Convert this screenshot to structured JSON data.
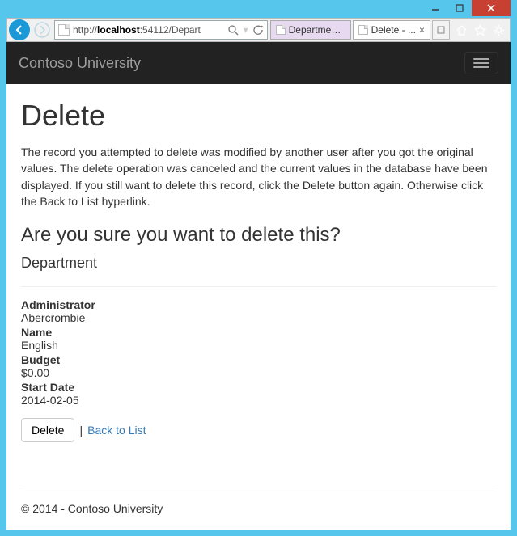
{
  "window": {
    "url_pre": "http://",
    "url_host": "localhost",
    "url_post": ":54112/Depart",
    "tab1": "Department...",
    "tab2": "Delete - ..."
  },
  "navbar": {
    "brand": "Contoso University"
  },
  "page": {
    "title": "Delete",
    "message": "The record you attempted to delete was modified by another user after you got the original values. The delete operation was canceled and the current values in the database have been displayed. If you still want to delete this record, click the Delete button again. Otherwise click the Back to List hyperlink.",
    "confirm": "Are you sure you want to delete this?",
    "entity": "Department"
  },
  "fields": {
    "admin_label": "Administrator",
    "admin_value": "Abercrombie",
    "name_label": "Name",
    "name_value": "English",
    "budget_label": "Budget",
    "budget_value": "$0.00",
    "start_label": "Start Date",
    "start_value": "2014-02-05"
  },
  "actions": {
    "delete": "Delete",
    "sep": " | ",
    "back": "Back to List"
  },
  "footer": "© 2014 - Contoso University"
}
